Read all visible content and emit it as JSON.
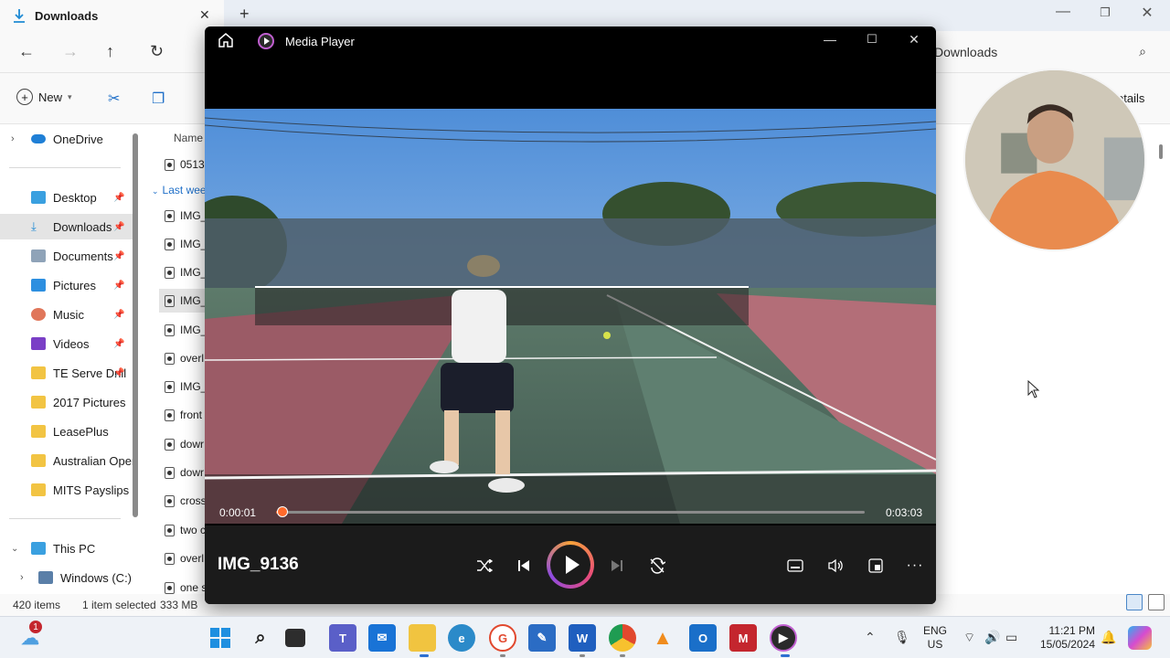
{
  "explorer": {
    "tab_title": "Downloads",
    "address": "Downloads",
    "toolbar": {
      "new_label": "New",
      "details_label": "etails"
    },
    "sidebar": [
      {
        "label": "OneDrive",
        "icon": "onedrive-icon"
      },
      {
        "label": "Desktop",
        "icon": "desktop-icon"
      },
      {
        "label": "Downloads",
        "icon": "download-icon"
      },
      {
        "label": "Documents",
        "icon": "documents-icon"
      },
      {
        "label": "Pictures",
        "icon": "pictures-icon"
      },
      {
        "label": "Music",
        "icon": "music-icon"
      },
      {
        "label": "Videos",
        "icon": "videos-icon"
      },
      {
        "label": "TE Serve Drill",
        "icon": "folder-icon"
      },
      {
        "label": "2017 Pictures",
        "icon": "folder-icon"
      },
      {
        "label": "LeasePlus",
        "icon": "folder-icon"
      },
      {
        "label": "Australian Open",
        "icon": "folder-icon"
      },
      {
        "label": "MITS Payslips",
        "icon": "folder-icon"
      },
      {
        "label": "This PC",
        "icon": "computer-icon"
      },
      {
        "label": "Windows (C:)",
        "icon": "drive-icon"
      }
    ],
    "list": {
      "header_name": "Name",
      "group_label": "Last wee",
      "rows": [
        "0513",
        "IMG_",
        "IMG_",
        "IMG_",
        "IMG_",
        "IMG_",
        "overl",
        "IMG_",
        "front",
        "dowr",
        "dowr",
        "cross",
        "two c",
        "overl",
        "one s"
      ]
    },
    "status": {
      "items": "420 items",
      "selected": "1 item selected",
      "size": "333 MB"
    }
  },
  "media_player": {
    "app_title": "Media Player",
    "current_time": "0:00:01",
    "total_time": "0:03:03",
    "progress": 0.011,
    "file_name": "IMG_9136",
    "accent_color": "#ff6a2b"
  },
  "taskbar": {
    "weather_badge": "1",
    "lang_line1": "ENG",
    "lang_line2": "US",
    "time": "11:21 PM",
    "date": "15/05/2024"
  }
}
